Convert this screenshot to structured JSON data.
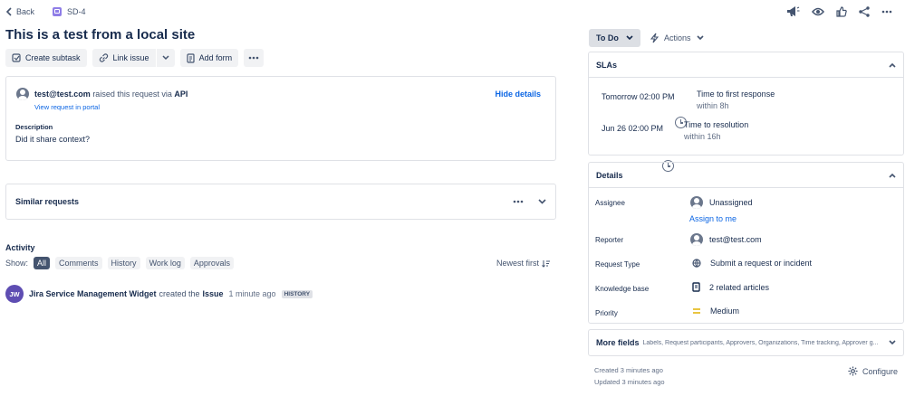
{
  "nav": {
    "back_label": "Back",
    "issue_key": "SD-4"
  },
  "issue": {
    "title": "This is a test from a local site"
  },
  "toolbar": {
    "create_subtask": "Create subtask",
    "link_issue": "Link issue",
    "add_form": "Add form"
  },
  "request": {
    "email": "test@test.com",
    "raised_text": "raised this request via",
    "channel": "API",
    "view_portal": "View request in portal",
    "hide_details": "Hide details",
    "description_label": "Description",
    "description_text": "Did it share context?"
  },
  "similar": {
    "label": "Similar requests"
  },
  "activity": {
    "heading": "Activity",
    "show_label": "Show:",
    "filters": [
      "All",
      "Comments",
      "History",
      "Work log",
      "Approvals"
    ],
    "sort_label": "Newest first",
    "entry": {
      "avatar_initials": "JW",
      "actor": "Jira Service Management Widget",
      "action": "created the",
      "object": "Issue",
      "time": "1 minute ago",
      "badge": "HISTORY"
    }
  },
  "status": {
    "current": "To Do",
    "actions_label": "Actions"
  },
  "slas": {
    "title": "SLAs",
    "items": [
      {
        "when": "Tomorrow 02:00 PM",
        "name": "Time to first response",
        "remaining": "within 8h"
      },
      {
        "when": "Jun 26 02:00 PM",
        "name": "Time to resolution",
        "remaining": "within 16h"
      }
    ]
  },
  "details": {
    "title": "Details",
    "assignee_label": "Assignee",
    "assignee_value": "Unassigned",
    "assign_to_me": "Assign to me",
    "reporter_label": "Reporter",
    "reporter_value": "test@test.com",
    "request_type_label": "Request Type",
    "request_type_value": "Submit a request or incident",
    "knowledge_label": "Knowledge base",
    "knowledge_value": "2 related articles",
    "priority_label": "Priority",
    "priority_value": "Medium"
  },
  "more_fields": {
    "label": "More fields",
    "list": "Labels, Request participants, Approvers, Organizations, Time tracking, Approver g..."
  },
  "footer": {
    "created": "Created 3 minutes ago",
    "updated": "Updated 3 minutes ago",
    "configure": "Configure"
  },
  "colors": {
    "accent": "#0c66e4",
    "priority": "#e2b203",
    "issue_type": "#8f7ee7"
  }
}
